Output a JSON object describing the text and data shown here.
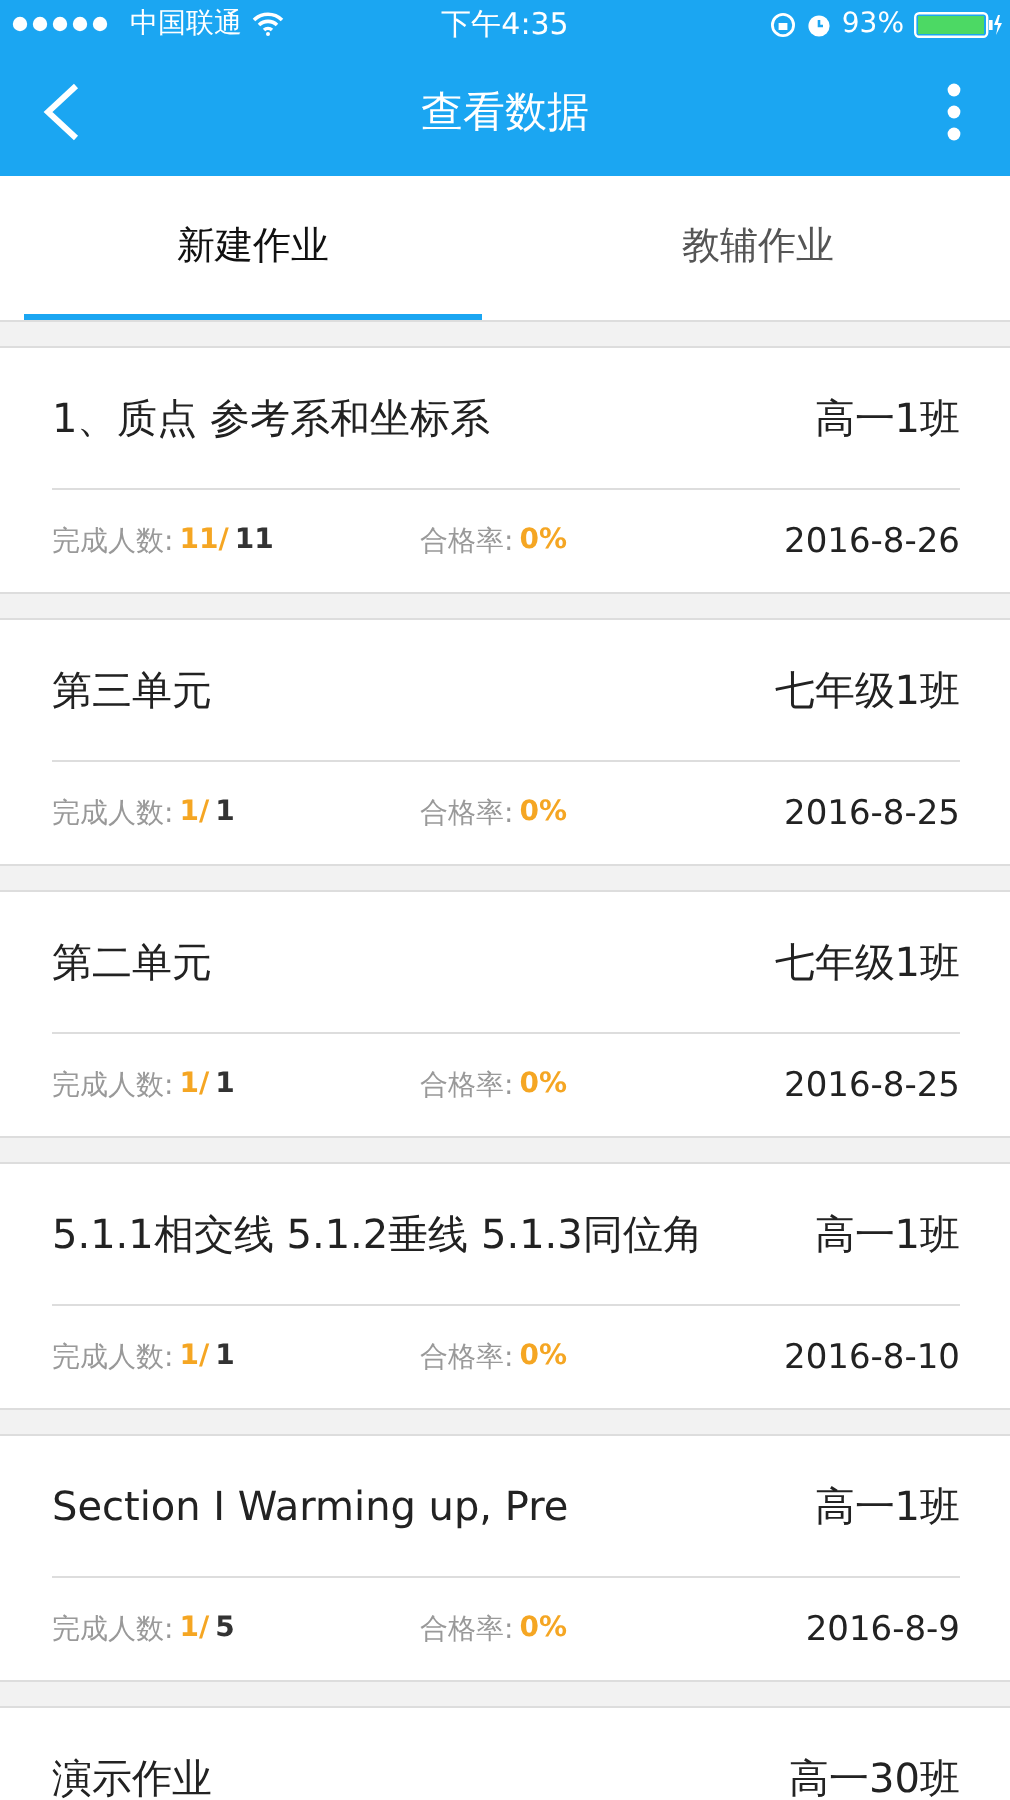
{
  "status_bar": {
    "carrier": "中国联通",
    "time": "下午4:35",
    "battery": "93%"
  },
  "nav": {
    "title": "查看数据"
  },
  "tabs": [
    {
      "label": "新建作业",
      "selected": true
    },
    {
      "label": "教辅作业",
      "selected": false
    }
  ],
  "assignments": [
    {
      "title": "1、质点  参考系和坐标系",
      "class": "高一1班",
      "stats": {
        "done_label": "完成人数:",
        "done": "11/",
        "total": "11",
        "pass_label": "合格率:",
        "pass_rate": "0%",
        "date": "2016-8-26"
      }
    },
    {
      "title": "第三单元",
      "class": "七年级1班",
      "stats": {
        "done_label": "完成人数:",
        "done": "1/",
        "total": "1",
        "pass_label": "合格率:",
        "pass_rate": "0%",
        "date": "2016-8-25"
      }
    },
    {
      "title": "第二单元",
      "class": "七年级1班",
      "stats": {
        "done_label": "完成人数:",
        "done": "1/",
        "total": "1",
        "pass_label": "合格率:",
        "pass_rate": "0%",
        "date": "2016-8-25"
      }
    },
    {
      "title": "5.1.1相交线 5.1.2垂线 5.1.3同位角",
      "class": "高一1班",
      "stats": {
        "done_label": "完成人数:",
        "done": "1/",
        "total": "1",
        "pass_label": "合格率:",
        "pass_rate": "0%",
        "date": "2016-8-10"
      }
    },
    {
      "title": "Section I Warming up, Pre",
      "class": "高一1班",
      "stats": {
        "done_label": "完成人数:",
        "done": "1/",
        "total": "5",
        "pass_label": "合格率:",
        "pass_rate": "0%",
        "date": "2016-8-9"
      }
    },
    {
      "title": "演示作业",
      "class": "高一30班"
    }
  ]
}
